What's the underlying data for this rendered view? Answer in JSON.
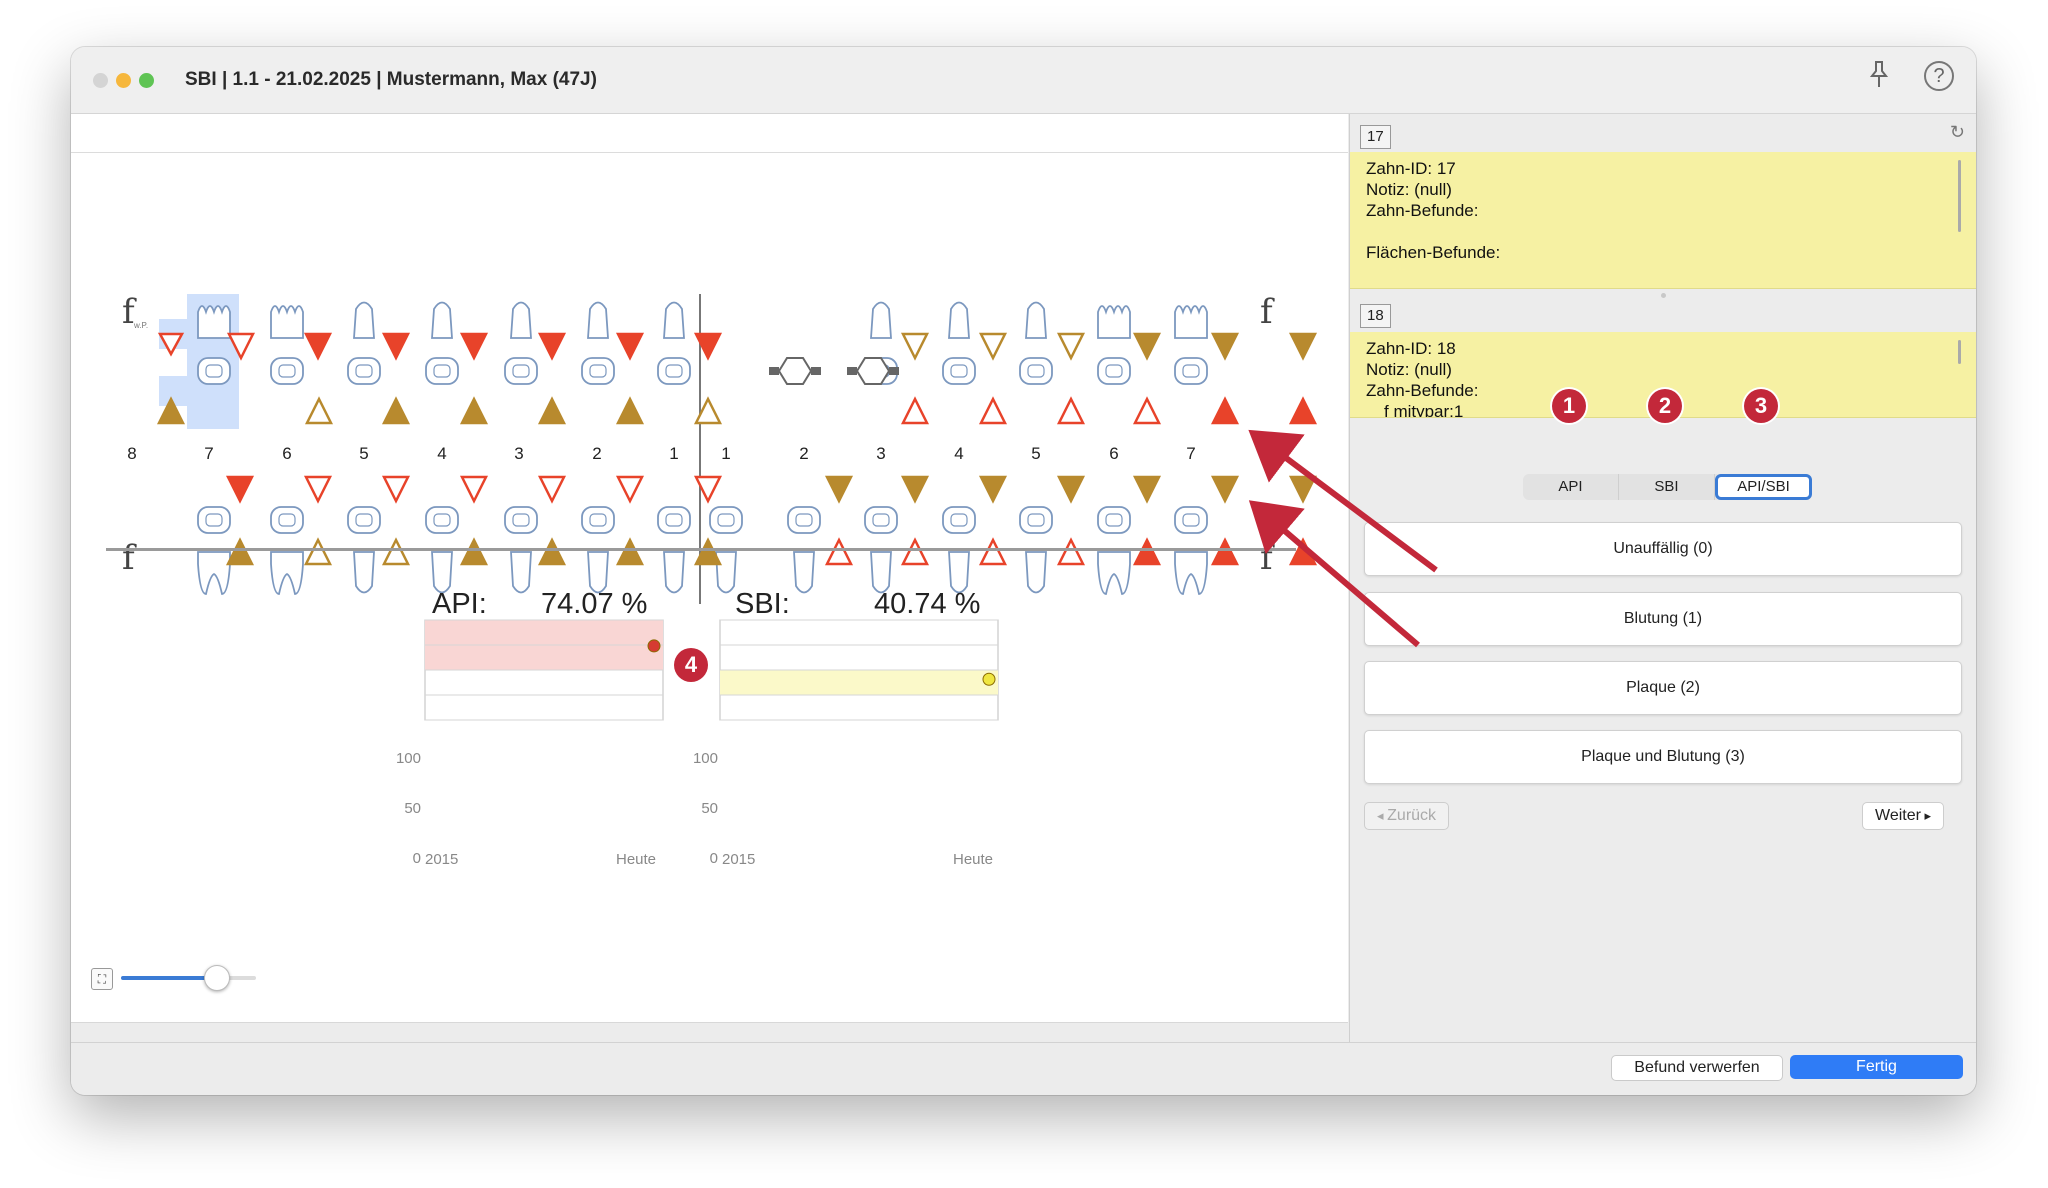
{
  "window": {
    "title": "SBI | 1.1 - 21.02.2025 | Mustermann, Max (47J)",
    "traffic_lights": [
      "#d4d4d4",
      "#f6b73c",
      "#5fc454"
    ],
    "pin_icon": "pin-icon",
    "help_icon": "?"
  },
  "chart_side": {
    "upper_markers": {
      "f_left": "f",
      "f_left_sub": "w.P.",
      "f_right": "f"
    },
    "lower_markers": {
      "f_left": "f",
      "f_right": "f"
    },
    "tooth_numbers_left": [
      "8",
      "7",
      "6",
      "5",
      "4",
      "3",
      "2",
      "1"
    ],
    "tooth_numbers_right": [
      "1",
      "2",
      "3",
      "4",
      "5",
      "6",
      "7",
      "8"
    ]
  },
  "stats": {
    "api_label": "API:",
    "api_value": "74.07 %",
    "sbi_label": "SBI:",
    "sbi_value": "40.74 %",
    "colors": {
      "api_band": "#f9d6d4",
      "sbi_band": "#fbf9c9",
      "api_dot": "#d53b32",
      "sbi_dot": "#efe640"
    }
  },
  "chart_data": [
    {
      "type": "line",
      "y_ticks": [
        "100",
        "50",
        "0"
      ],
      "x_labels": [
        "2015",
        "Heute"
      ],
      "ylim": [
        0,
        100
      ],
      "series": [
        {
          "values": [
            74.07
          ]
        }
      ]
    },
    {
      "type": "line",
      "y_ticks": [
        "100",
        "50",
        "0"
      ],
      "x_labels": [
        "2015",
        "Heute"
      ],
      "ylim": [
        0,
        100
      ],
      "series": [
        {
          "values": [
            40.74
          ]
        }
      ]
    }
  ],
  "notes": [
    {
      "tag": "17",
      "lines": [
        "Zahn-ID: 17",
        "Notiz: (null)",
        "Zahn-Befunde:",
        "",
        "Flächen-Befunde:"
      ]
    },
    {
      "tag": "18",
      "lines": [
        "Zahn-ID: 18",
        "Notiz: (null)",
        "Zahn-Befunde:",
        "f mitypar:1"
      ]
    }
  ],
  "segmented": {
    "items": [
      "API",
      "SBI",
      "API/SBI"
    ],
    "selected": "API/SBI"
  },
  "options": [
    "Unauffällig (0)",
    "Blutung (1)",
    "Plaque (2)",
    "Plaque und Blutung (3)"
  ],
  "nav": {
    "back": "Zurück",
    "next": "Weiter"
  },
  "footer": {
    "discard": "Befund verwerfen",
    "done": "Fertig"
  },
  "badges": [
    "1",
    "2",
    "3",
    "4"
  ],
  "colors": {
    "red": "#e8432a",
    "gold": "#b88a2e",
    "blue": "#3a7bd5",
    "badge": "#c3283a",
    "note_bg": "#f6f1a3"
  }
}
